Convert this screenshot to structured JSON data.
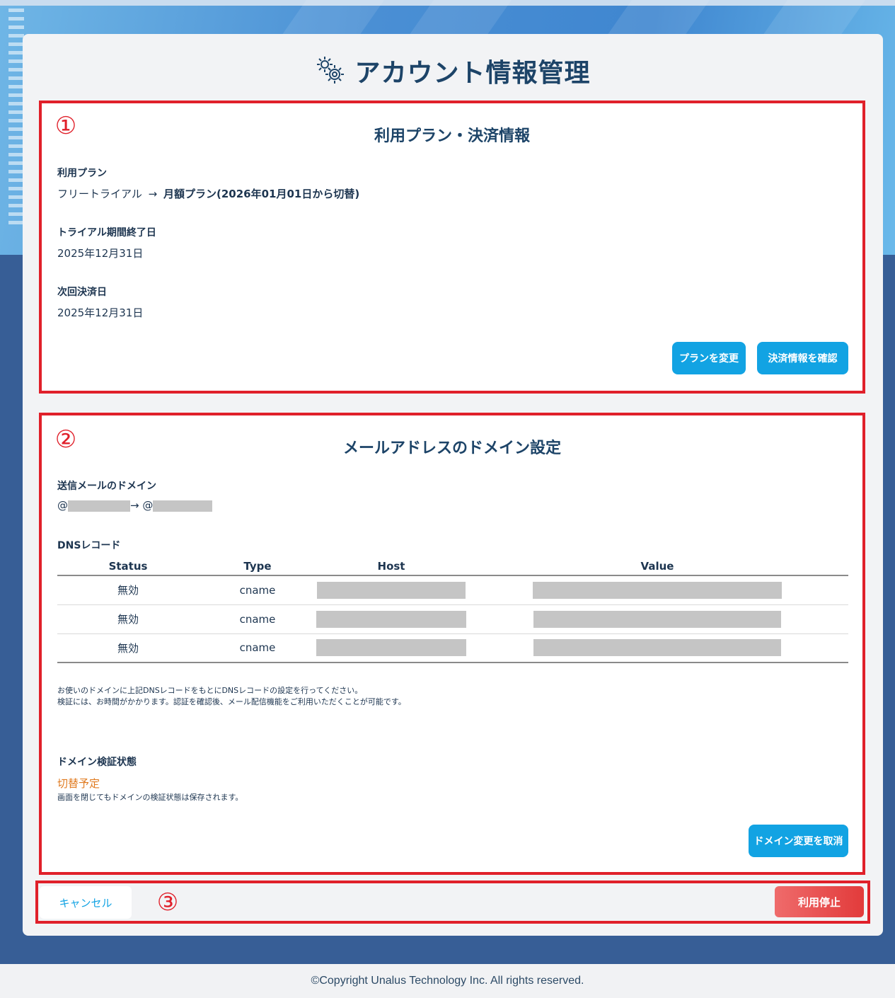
{
  "page": {
    "title": "アカウント情報管理",
    "footer": "©Copyright Unalus Technology Inc. All rights reserved."
  },
  "plan_section": {
    "marker": "①",
    "title": "利用プラン・決済情報",
    "plan_label": "利用プラン",
    "plan_current": "フリートライアル",
    "plan_arrow": "→",
    "plan_next": "月額プラン(2026年01月01日から切替)",
    "trial_end_label": "トライアル期間終了日",
    "trial_end_value": "2025年12月31日",
    "next_payment_label": "次回決済日",
    "next_payment_value": "2025年12月31日",
    "change_plan_button": "プランを変更",
    "payment_info_button": "決済情報を確認"
  },
  "domain_section": {
    "marker": "②",
    "title": "メールアドレスのドメイン設定",
    "sender_domain_label": "送信メールのドメイン",
    "at1": "@",
    "arrow": "→",
    "at2": "@",
    "dns_label": "DNSレコード",
    "table": {
      "headers": [
        "Status",
        "Type",
        "Host",
        "Value"
      ],
      "rows": [
        {
          "status": "無効",
          "type": "cname"
        },
        {
          "status": "無効",
          "type": "cname"
        },
        {
          "status": "無効",
          "type": "cname"
        }
      ]
    },
    "note_line1": "お使いのドメインに上記DNSレコードをもとにDNSレコードの設定を行ってください。",
    "note_line2": "検証には、お時間がかかります。認証を確認後、メール配信機能をご利用いただくことが可能です。",
    "verify_label": "ドメイン検証状態",
    "verify_status": "切替予定",
    "verify_note": "画面を閉じてもドメインの検証状態は保存されます。",
    "cancel_domain_button": "ドメイン変更を取消",
    "colors": {
      "status_orange": "#e07a1f"
    }
  },
  "actions": {
    "marker": "③",
    "cancel_button": "キャンセル",
    "stop_button": "利用停止"
  },
  "colors": {
    "accent_blue": "#12a3e3",
    "highlight_red": "#e0202a",
    "title_navy": "#1d4468"
  }
}
